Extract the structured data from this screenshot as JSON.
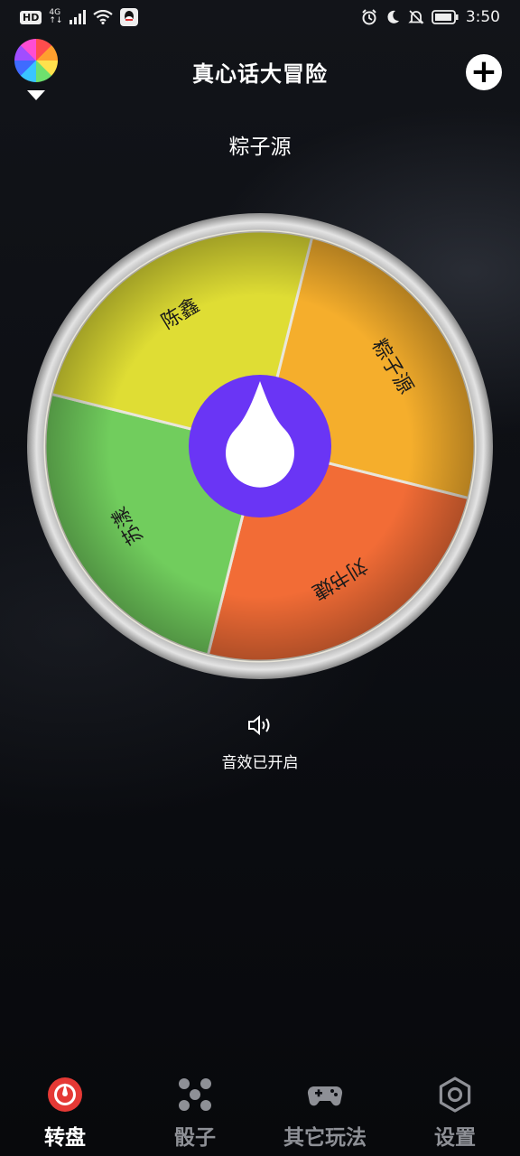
{
  "status_bar": {
    "hd": "HD",
    "network": "4G",
    "network_sub": "↑↓",
    "time": "3:50"
  },
  "header": {
    "title": "真心话大冒险",
    "add_icon": "plus-icon",
    "palette_icon": "color-wheel-icon"
  },
  "result": "粽子源",
  "wheel": {
    "segments": [
      {
        "label": "粽子源",
        "color": "#F5AE2C"
      },
      {
        "label": "刘书婕",
        "color": "#F26C36"
      },
      {
        "label": "苏漾",
        "color": "#71CD5D"
      },
      {
        "label": "陈鑫",
        "color": "#DFDD34"
      }
    ],
    "hub_color": "#6A35F5",
    "rim_color": "#CFCFCF"
  },
  "sound": {
    "icon": "speaker-icon",
    "label": "音效已开启"
  },
  "nav": {
    "items": [
      {
        "label": "转盘",
        "icon": "wheel-icon",
        "active": true
      },
      {
        "label": "骰子",
        "icon": "dice-icon",
        "active": false
      },
      {
        "label": "其它玩法",
        "icon": "gamepad-icon",
        "active": false
      },
      {
        "label": "设置",
        "icon": "settings-icon",
        "active": false
      }
    ]
  },
  "colors": {
    "accent_red": "#E53935",
    "inactive": "#8E9096"
  }
}
